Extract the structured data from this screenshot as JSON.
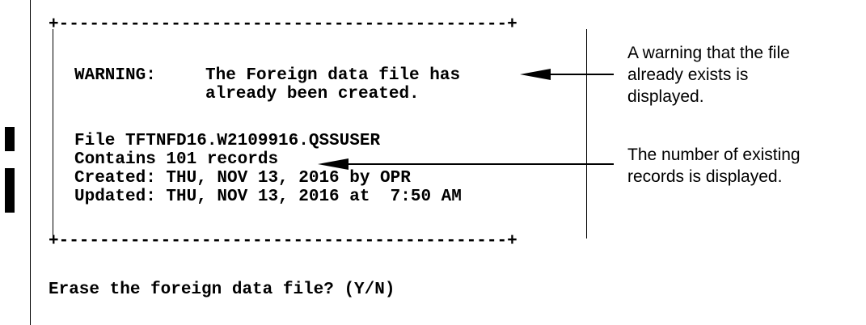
{
  "box": {
    "top_border": "+--------------------------------------------+",
    "bottom_border": "+--------------------------------------------+"
  },
  "warning": {
    "label": "WARNING:",
    "line1": "The Foreign data file has",
    "line2": "already been created."
  },
  "file_info": {
    "file_line": "File TFTNFD16.W2109916.QSSUSER",
    "records_line": "Contains 101 records",
    "created_line": "Created: THU, NOV 13, 2016 by OPR",
    "updated_line": "Updated: THU, NOV 13, 2016 at  7:50 AM"
  },
  "prompt": {
    "text": "Erase the foreign data file? (Y/N)"
  },
  "annotations": {
    "warning_note": [
      "A warning that the file",
      "already exists is",
      "displayed."
    ],
    "records_note": [
      "The number of existing",
      "records is displayed."
    ]
  }
}
